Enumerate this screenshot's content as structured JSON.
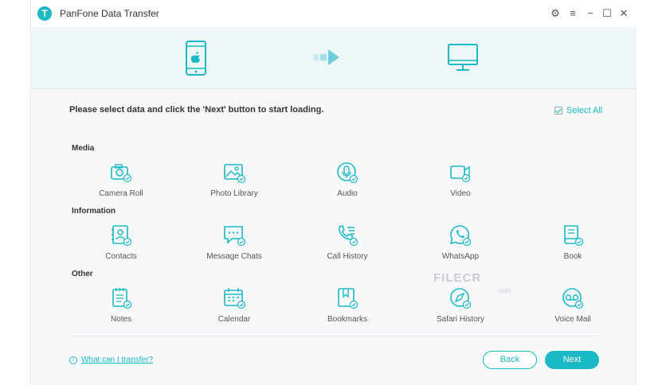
{
  "app": {
    "title": "PanFone Data Transfer",
    "logo_letter": "T"
  },
  "titlebar_icons": [
    "gear-icon",
    "menu-icon",
    "minimize-icon",
    "maximize-icon",
    "close-icon"
  ],
  "main": {
    "instruction": "Please select data and click the 'Next' button to start loading.",
    "select_all": "Select All"
  },
  "groups": {
    "media": {
      "label": "Media",
      "items": [
        {
          "label": "Camera Roll",
          "icon": "camera-icon"
        },
        {
          "label": "Photo Library",
          "icon": "photo-icon"
        },
        {
          "label": "Audio",
          "icon": "microphone-icon"
        },
        {
          "label": "Video",
          "icon": "video-icon"
        }
      ]
    },
    "information": {
      "label": "Information",
      "items": [
        {
          "label": "Contacts",
          "icon": "contacts-icon"
        },
        {
          "label": "Message Chats",
          "icon": "chat-icon"
        },
        {
          "label": "Call History",
          "icon": "phone-icon"
        },
        {
          "label": "WhatsApp",
          "icon": "whatsapp-icon"
        },
        {
          "label": "Book",
          "icon": "book-icon"
        }
      ]
    },
    "other": {
      "label": "Other",
      "items": [
        {
          "label": "Notes",
          "icon": "notes-icon"
        },
        {
          "label": "Calendar",
          "icon": "calendar-icon"
        },
        {
          "label": "Bookmarks",
          "icon": "bookmark-icon"
        },
        {
          "label": "Safari History",
          "icon": "compass-icon"
        },
        {
          "label": "Voice Mail",
          "icon": "voicemail-icon"
        }
      ]
    }
  },
  "footer": {
    "help_link": "What can I transfer?",
    "back_label": "Back",
    "next_label": "Next"
  },
  "watermark": {
    "text": "FILECR",
    "suffix": ".com"
  },
  "colors": {
    "accent": "#1bb8c6",
    "background": "#f6f8f9"
  }
}
